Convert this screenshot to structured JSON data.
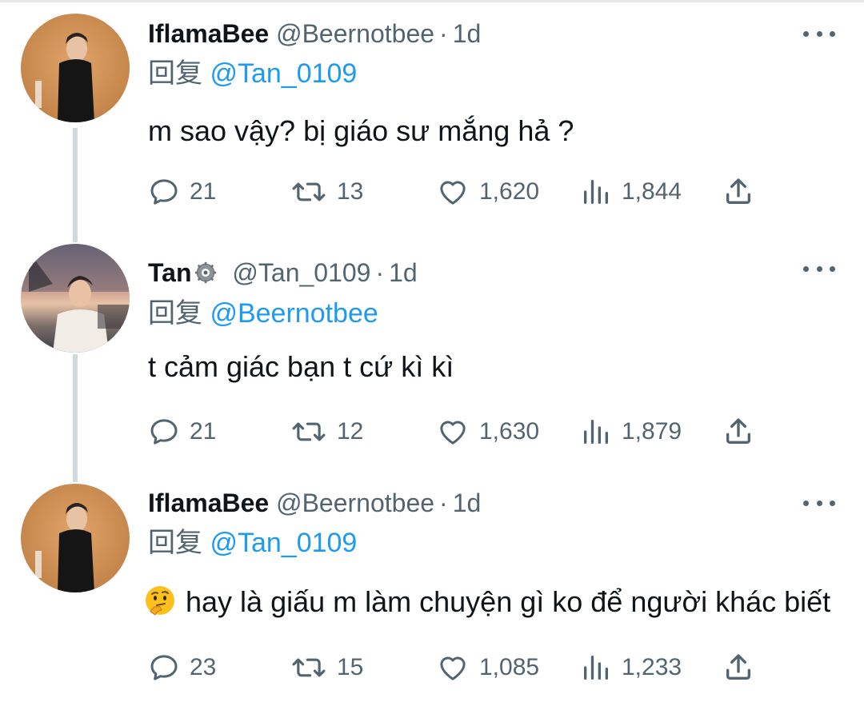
{
  "tweets": [
    {
      "display_name": "IflamaBee",
      "handle": "@Beernotbee",
      "separator": "·",
      "time": "1d",
      "replying_prefix": "回复",
      "replying_to": "@Tan_0109",
      "text": "m sao vậy? bị giáo sư mắng hả ?",
      "replies": "21",
      "retweets": "13",
      "likes": "1,620",
      "views": "1,844"
    },
    {
      "display_name": "Tan",
      "handle": "@Tan_0109",
      "separator": "·",
      "time": "1d",
      "replying_prefix": "回复",
      "replying_to": "@Beernotbee",
      "text": "t cảm giác bạn t cứ kì kì",
      "replies": "21",
      "retweets": "12",
      "likes": "1,630",
      "views": "1,879"
    },
    {
      "display_name": "IflamaBee",
      "handle": "@Beernotbee",
      "separator": "·",
      "time": "1d",
      "replying_prefix": "回复",
      "replying_to": "@Tan_0109",
      "text": "hay là giấu m làm chuyện gì ko để người khác biết",
      "replies": "23",
      "retweets": "15",
      "likes": "1,085",
      "views": "1,233"
    }
  ],
  "icons": {
    "reply": "reply-icon",
    "retweet": "retweet-icon",
    "like": "heart-icon",
    "views": "views-icon",
    "share": "share-icon",
    "more": "more-icon",
    "badge": "gear-badge-icon",
    "emoji": "thinking-face-emoji"
  },
  "colors": {
    "link": "#1d9bf0",
    "secondary_text": "#536471",
    "primary_text": "#0f1419",
    "thread_line": "#cfd9de"
  }
}
